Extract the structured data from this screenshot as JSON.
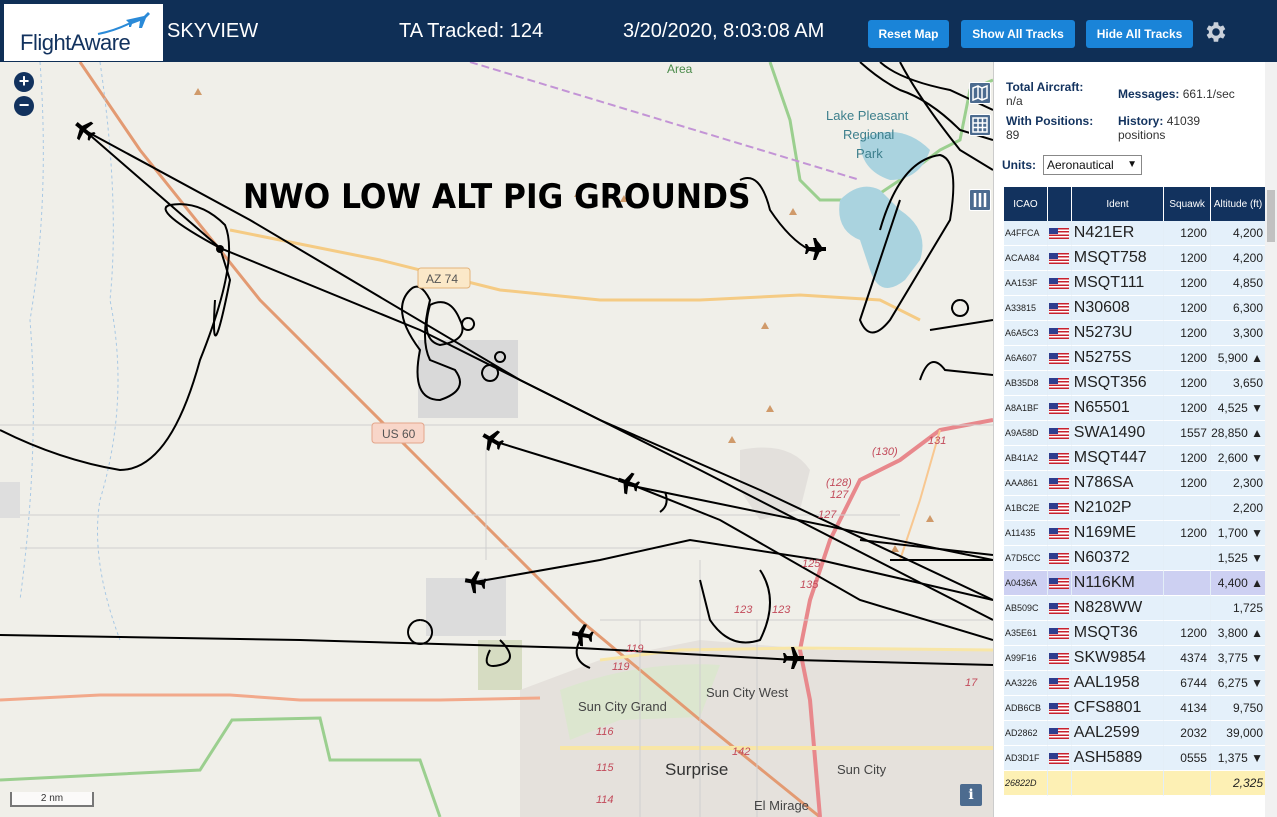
{
  "header": {
    "logo_text": "FlightAware",
    "title": "SKYVIEW",
    "tracked": "TA Tracked: 124",
    "datetime": "3/20/2020, 8:03:08 AM",
    "reset_map": "Reset Map",
    "show_all_tracks": "Show All Tracks",
    "hide_all_tracks": "Hide All Tracks",
    "settings_icon": "gear-icon"
  },
  "map": {
    "overlay_title": "NWO LOW ALT PIG GROUNDS",
    "labels": {
      "area": "Area",
      "lake1": "Lake Pleasant",
      "lake2": "Regional",
      "lake3": "Park",
      "az74": "AZ 74",
      "us60": "US 60",
      "r130": "(130)",
      "r131": "131",
      "r128": "(128)",
      "r127a": "127",
      "r127b": "127",
      "r125": "125",
      "r135": "135",
      "r123a": "123",
      "r123b": "123",
      "r119a": "119",
      "r119b": "119",
      "r116": "116",
      "r115": "115",
      "r114": "114",
      "r142": "142",
      "r17": "17",
      "sun_city_west": "Sun City West",
      "sun_city_grand": "Sun City Grand",
      "surprise": "Surprise",
      "sun_city": "Sun City",
      "el_mirage": "El Mirage"
    },
    "scale": "2 nm",
    "zoom_in": "+",
    "zoom_out": "−",
    "info": "i"
  },
  "sidebar": {
    "total_aircraft_label": "Total Aircraft:",
    "total_aircraft_value": "n/a",
    "with_positions_label": "With Positions:",
    "with_positions_value": "89",
    "messages_label": "Messages:",
    "messages_value": "661.1/sec",
    "history_label": "History:",
    "history_value": "41039",
    "history_unit": "positions",
    "units_label": "Units:",
    "units_value": "Aeronautical",
    "columns": [
      "ICAO",
      "",
      "Ident",
      "Squawk",
      "Altitude (ft)"
    ],
    "rows": [
      {
        "icao": "A4FFCA",
        "ident": "N421ER",
        "squawk": "1200",
        "alt": "4,200"
      },
      {
        "icao": "ACAA84",
        "ident": "MSQT758",
        "squawk": "1200",
        "alt": "4,200"
      },
      {
        "icao": "AA153F",
        "ident": "MSQT111",
        "squawk": "1200",
        "alt": "4,850"
      },
      {
        "icao": "A33815",
        "ident": "N30608",
        "squawk": "1200",
        "alt": "6,300"
      },
      {
        "icao": "A6A5C3",
        "ident": "N5273U",
        "squawk": "1200",
        "alt": "3,300"
      },
      {
        "icao": "A6A607",
        "ident": "N5275S",
        "squawk": "1200",
        "alt": "5,900 ▲"
      },
      {
        "icao": "AB35D8",
        "ident": "MSQT356",
        "squawk": "1200",
        "alt": "3,650"
      },
      {
        "icao": "A8A1BF",
        "ident": "N65501",
        "squawk": "1200",
        "alt": "4,525 ▼"
      },
      {
        "icao": "A9A58D",
        "ident": "SWA1490",
        "squawk": "1557",
        "alt": "28,850 ▲"
      },
      {
        "icao": "AB41A2",
        "ident": "MSQT447",
        "squawk": "1200",
        "alt": "2,600 ▼"
      },
      {
        "icao": "AAA861",
        "ident": "N786SA",
        "squawk": "1200",
        "alt": "2,300"
      },
      {
        "icao": "A1BC2E",
        "ident": "N2102P",
        "squawk": "",
        "alt": "2,200"
      },
      {
        "icao": "A11435",
        "ident": "N169ME",
        "squawk": "1200",
        "alt": "1,700 ▼"
      },
      {
        "icao": "A7D5CC",
        "ident": "N60372",
        "squawk": "",
        "alt": "1,525 ▼"
      },
      {
        "icao": "A0436A",
        "ident": "N116KM",
        "squawk": "",
        "alt": "4,400 ▲",
        "selected": true
      },
      {
        "icao": "AB509C",
        "ident": "N828WW",
        "squawk": "",
        "alt": "1,725"
      },
      {
        "icao": "A35E61",
        "ident": "MSQT36",
        "squawk": "1200",
        "alt": "3,800 ▲"
      },
      {
        "icao": "A99F16",
        "ident": "SKW9854",
        "squawk": "4374",
        "alt": "3,775 ▼"
      },
      {
        "icao": "AA3226",
        "ident": "AAL1958",
        "squawk": "6744",
        "alt": "6,275 ▼"
      },
      {
        "icao": "ADB6CB",
        "ident": "CFS8801",
        "squawk": "4134",
        "alt": "9,750"
      },
      {
        "icao": "AD2862",
        "ident": "AAL2599",
        "squawk": "2032",
        "alt": "39,000"
      },
      {
        "icao": "AD3D1F",
        "ident": "ASH5889",
        "squawk": "0555",
        "alt": "1,375 ▼"
      },
      {
        "icao": "26822D",
        "ident": "",
        "squawk": "",
        "alt": "2,325",
        "yellow": true,
        "noflag": true
      }
    ]
  },
  "colors": {
    "header_bg": "#0f2f56",
    "button_bg": "#1a84d8",
    "table_header": "#12325e",
    "row_bg": "#e4f0fa",
    "row_selected": "#cdd0f2",
    "row_unpositioned": "#fdf0b4"
  }
}
